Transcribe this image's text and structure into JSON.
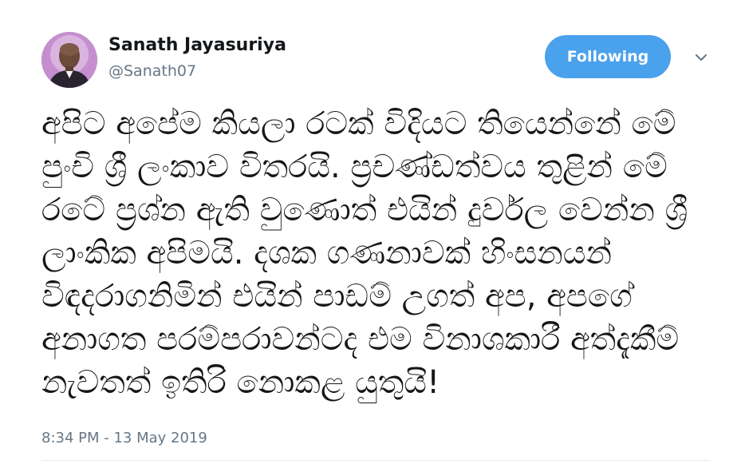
{
  "author": {
    "name": "Sanath Jayasuriya",
    "handle": "@Sanath07"
  },
  "follow_button": {
    "label": "Following"
  },
  "menu": {
    "icon": "chevron-down-icon"
  },
  "tweet": {
    "text": "අපිට අපේම කියලා රටක් විදියට තියෙන්නේ මේ පුංචි ශ්‍රී ලංකාව විතරයි. ප්‍රචණ්ඩත්වය තුළින් මේ රටේ ප්‍රශ්න ඇති වුණොත් එයින් දුර්වල වෙන්න ශ්‍රී ලාංකික අපිමයි. දශක ගණනාවක් හිංසනයන් විඳදරාගනිමින් එයින් පාඩම් උගත් අප, අපගේ අනාගත පරම්පරාවන්ටද එම විනාශකාරී අත්දැකීම් නැවතත් ඉතිරි නොකළ යුතුයි!",
    "timestamp": "8:34 PM - 13 May 2019"
  },
  "colors": {
    "follow_button_bg": "#4aa1ec",
    "secondary_text": "#657786",
    "primary_text": "#14171a"
  }
}
